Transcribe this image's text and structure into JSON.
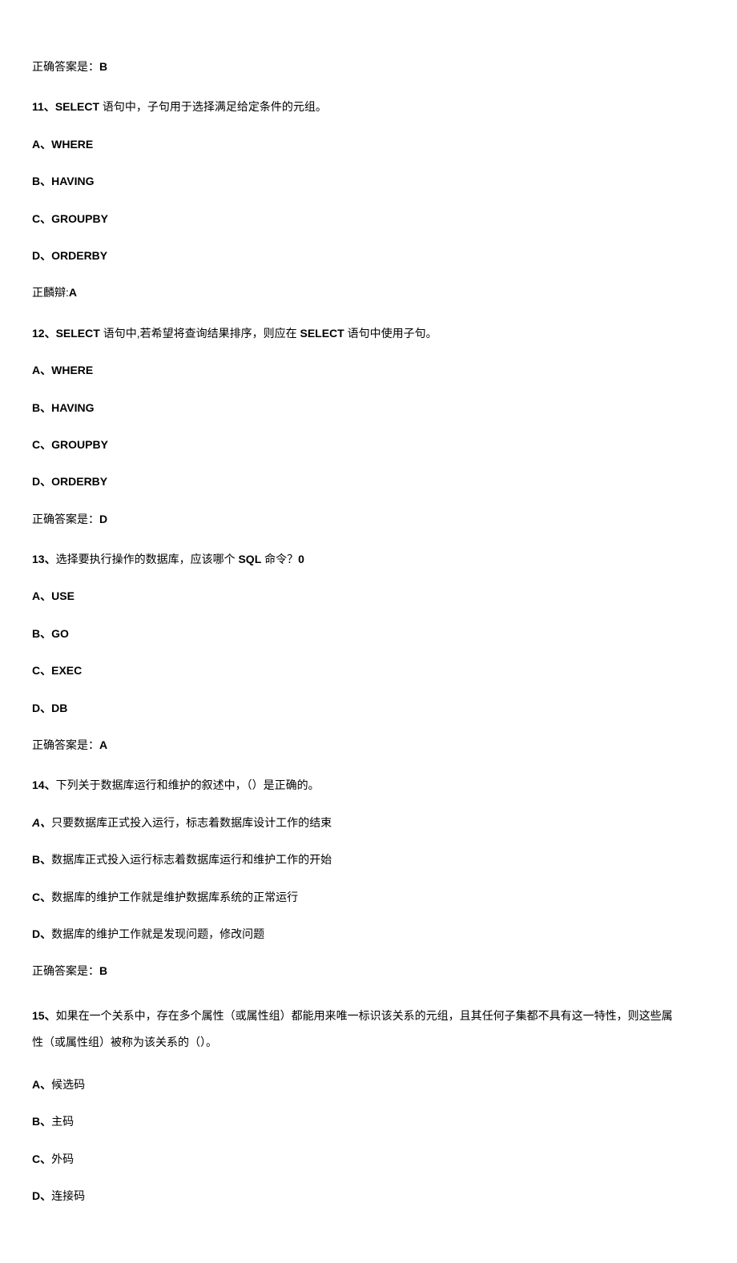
{
  "answer0": {
    "prefix": "正确答案是：",
    "value": "B"
  },
  "q11": {
    "number": "11、",
    "prefix": "SELECT",
    "rest": " 语句中，子句用于选择满足给定条件的元组。",
    "optA": {
      "label": "A、",
      "value": "WHERE"
    },
    "optB": {
      "label": "B、",
      "value": "HAVING"
    },
    "optC": {
      "label": "C、",
      "value": "GROUPBY"
    },
    "optD": {
      "label": "D、",
      "value": "ORDERBY"
    },
    "answer": {
      "prefix": "正麟辯:",
      "value": "A"
    }
  },
  "q12": {
    "number": "12、",
    "prefix": "SELECT",
    "mid1": " 语句中,若希望将查询结果排序，则应在 ",
    "mid2": "SELECT",
    "rest": " 语句中使用子句。",
    "optA": {
      "label": "A、",
      "value": "WHERE"
    },
    "optB": {
      "label": "B、",
      "value": "HAVING"
    },
    "optC": {
      "label": "C、",
      "value": "GROUPBY"
    },
    "optD": {
      "label": "D、",
      "value": "ORDERBY"
    },
    "answer": {
      "prefix": "正确答案是：",
      "value": "D"
    }
  },
  "q13": {
    "number": "13、",
    "text1": "选择要执行操作的数据库，应该哪个 ",
    "text2": "SQL",
    "text3": " 命令？",
    "text4": "0",
    "optA": {
      "label": "A、",
      "value": "USE"
    },
    "optB": {
      "label": "B、",
      "value": "GO"
    },
    "optC": {
      "label": "C、",
      "value": "EXEC"
    },
    "optD": {
      "label": "D、",
      "value": "DB"
    },
    "answer": {
      "prefix": "正确答案是：",
      "value": "A"
    }
  },
  "q14": {
    "number": "14、",
    "text": "下列关于数据库运行和维护的叙述中，（）是正确的。",
    "optA": {
      "label": "A、",
      "value": "只要数据库正式投入运行，标志着数据库设计工作的结束"
    },
    "optB": {
      "label": "B、",
      "value": "数据库正式投入运行标志着数据库运行和维护工作的开始"
    },
    "optC": {
      "label": "C、",
      "value": "数据库的维护工作就是维护数据库系统的正常运行"
    },
    "optD": {
      "label": "D、",
      "value": "数据库的维护工作就是发现问题，修改问题"
    },
    "answer": {
      "prefix": "正确答案是：",
      "value": "B"
    }
  },
  "q15": {
    "number": "15、",
    "text_line1": "如果在一个关系中，存在多个属性（或属性组）都能用来唯一标识该关系的元组，且其任何子集都不具有这一特性，则这些属",
    "text_line2": "性（或属性组）被称为该关系的（）。",
    "optA": {
      "label": "A、",
      "value": "候选码"
    },
    "optB": {
      "label": "B、",
      "value": "主码"
    },
    "optC": {
      "label": "C、",
      "value": "外码"
    },
    "optD": {
      "label": "D、",
      "value": "连接码"
    }
  }
}
